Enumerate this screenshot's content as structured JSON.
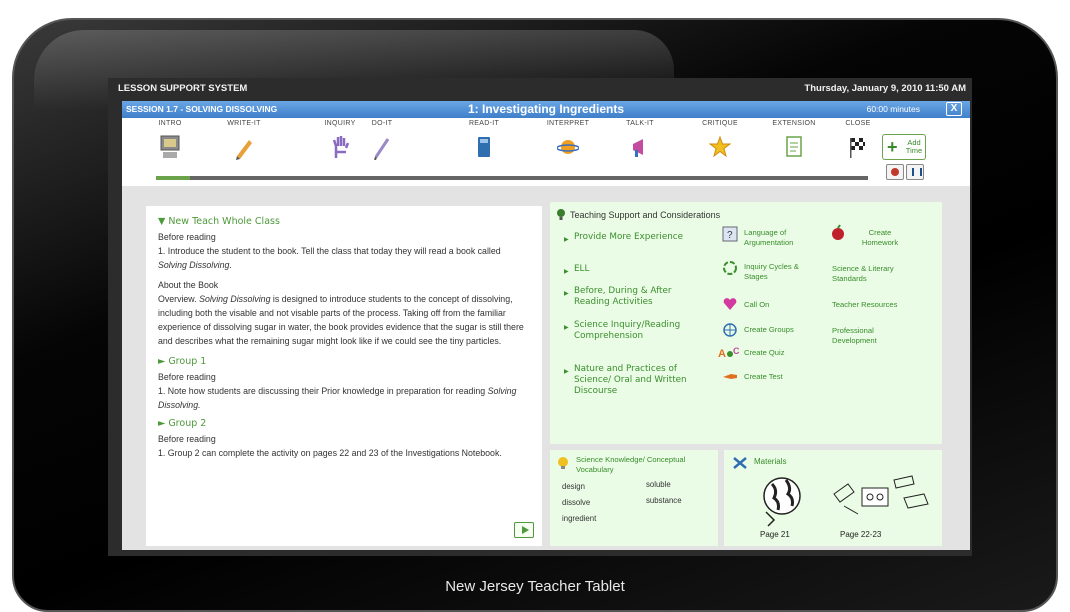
{
  "system": {
    "title": "LESSON SUPPORT SYSTEM",
    "datetime": "Thursday, January 9, 2010  11:50 AM"
  },
  "session": {
    "label": "SESSION 1.7 - SOLVING DISSOLVING",
    "title": "1: Investigating Ingredients",
    "minutes": "60:00 minutes",
    "close_label": "X"
  },
  "phases": [
    {
      "label": "INTRO",
      "icon": "computer-icon",
      "color": "#8a8a8a"
    },
    {
      "label": "WRITE-IT",
      "icon": "pencil-icon",
      "color": "#e8a13a"
    },
    {
      "label": "INQUIRY",
      "icon": "hand-icon",
      "color": "#8a6bbf"
    },
    {
      "label": "DO-IT",
      "icon": "pen-icon",
      "color": "#9a8ac8"
    },
    {
      "label": "READ-IT",
      "icon": "book-icon",
      "color": "#2f6fb0"
    },
    {
      "label": "INTERPRET",
      "icon": "planet-icon",
      "color": "#f0a020"
    },
    {
      "label": "TALK-IT",
      "icon": "megaphone-icon",
      "color": "#c44ba0"
    },
    {
      "label": "CRITIQUE",
      "icon": "star-icon",
      "color": "#f0c020"
    },
    {
      "label": "EXTENSION",
      "icon": "document-icon",
      "color": "#6aa34a"
    },
    {
      "label": "CLOSE",
      "icon": "checkered-flag-icon",
      "color": "#222222"
    }
  ],
  "controls": {
    "add_time": "Add Time",
    "add_symbol": "+"
  },
  "lesson": {
    "section1_head": "▼ New Teach Whole Class",
    "before_reading_1": "Before reading",
    "step1": "1. Introduce the student to the book. Tell the class that today they will read a book called ",
    "step1_book": "Solving Dissolving",
    "about_head": "About the Book",
    "overview_a": "Overview. ",
    "overview_book": "Solving Dissolving",
    "overview_b": " is designed to introduce students to the concept of dissolving, including both the visable and not visable parts of the process. Taking off from the familiar experience of dissolving sugar in water, the book provides evidence that the sugar is still there and describes what the remaining sugar might look like if we could see the tiny particles.",
    "group1_head": "► Group 1",
    "before_reading_2": "Before reading",
    "group1_text": "1. Note how students are discussing their Prior knowledge in preparation for reading ",
    "group1_book": "Solving Dissolving.",
    "group2_head": "► Group 2",
    "before_reading_3": "Before reading",
    "group2_text": "1. Group 2 can complete the activity on pages 22 and 23 of the Investigations Notebook."
  },
  "support": {
    "title": "Teaching Support and Considerations",
    "links": [
      "Provide More Experience",
      "ELL",
      "Before, During & After Reading Activities",
      "Science Inquiry/Reading Comprehension",
      "Nature and Practices of Science/ Oral and Written Discourse"
    ],
    "resources_col1": [
      "Language of Argumentation",
      "Inquiry Cycles & Stages",
      "Call On",
      "Create Groups",
      "Create Quiz",
      "Create Test"
    ],
    "resources_col2": [
      "Create Homework",
      "Science & Literary Standards",
      "Teacher Resources",
      "Professional Development"
    ]
  },
  "vocab": {
    "title": "Science Knowledge/ Conceptual Vocabulary",
    "words": [
      "design",
      "soluble",
      "dissolve",
      "substance",
      "ingredient"
    ]
  },
  "materials": {
    "title": "Materials",
    "page1": "Page 21",
    "page2": "Page 22-23"
  },
  "device_caption": "New Jersey Teacher Tablet",
  "accent_colors": {
    "session_blue": "#3f7fc9",
    "link_green": "#3a8e2c",
    "panel_green": "#eafce6"
  }
}
